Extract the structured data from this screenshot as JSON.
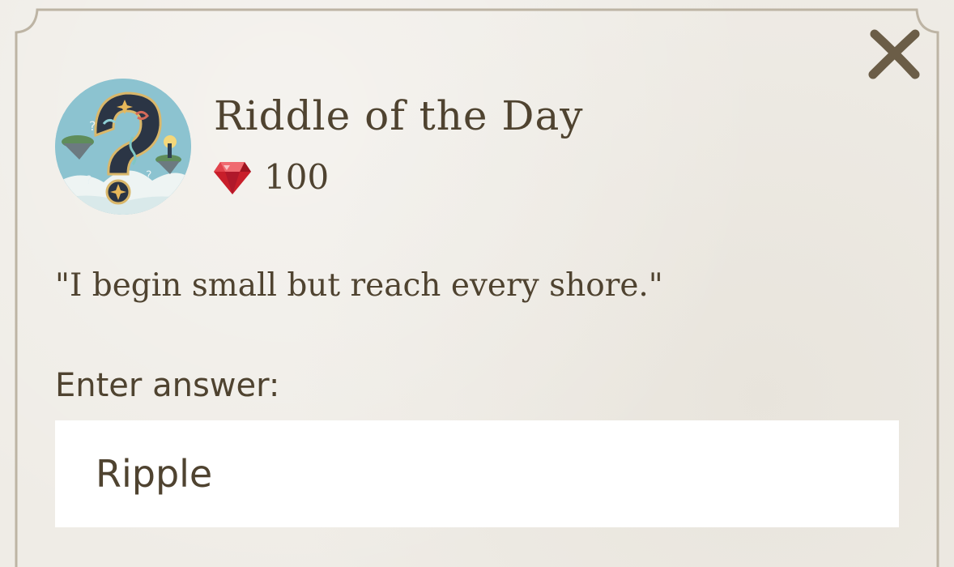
{
  "dialog": {
    "title": "Riddle of the Day",
    "reward": {
      "icon": "ruby-gem-icon",
      "value": "100",
      "gem_color": "#c81e2a"
    },
    "riddle_text": "\"I begin small but reach every shore.\"",
    "answer_label": "Enter answer:",
    "answer_value": "Ripple",
    "close_icon": "close-x-icon",
    "avatar_icon": "question-mark-emblem-icon"
  },
  "theme": {
    "background": "#efece6",
    "text": "#4f4330",
    "frame": "#bdb4a4",
    "input_background": "#ffffff"
  }
}
